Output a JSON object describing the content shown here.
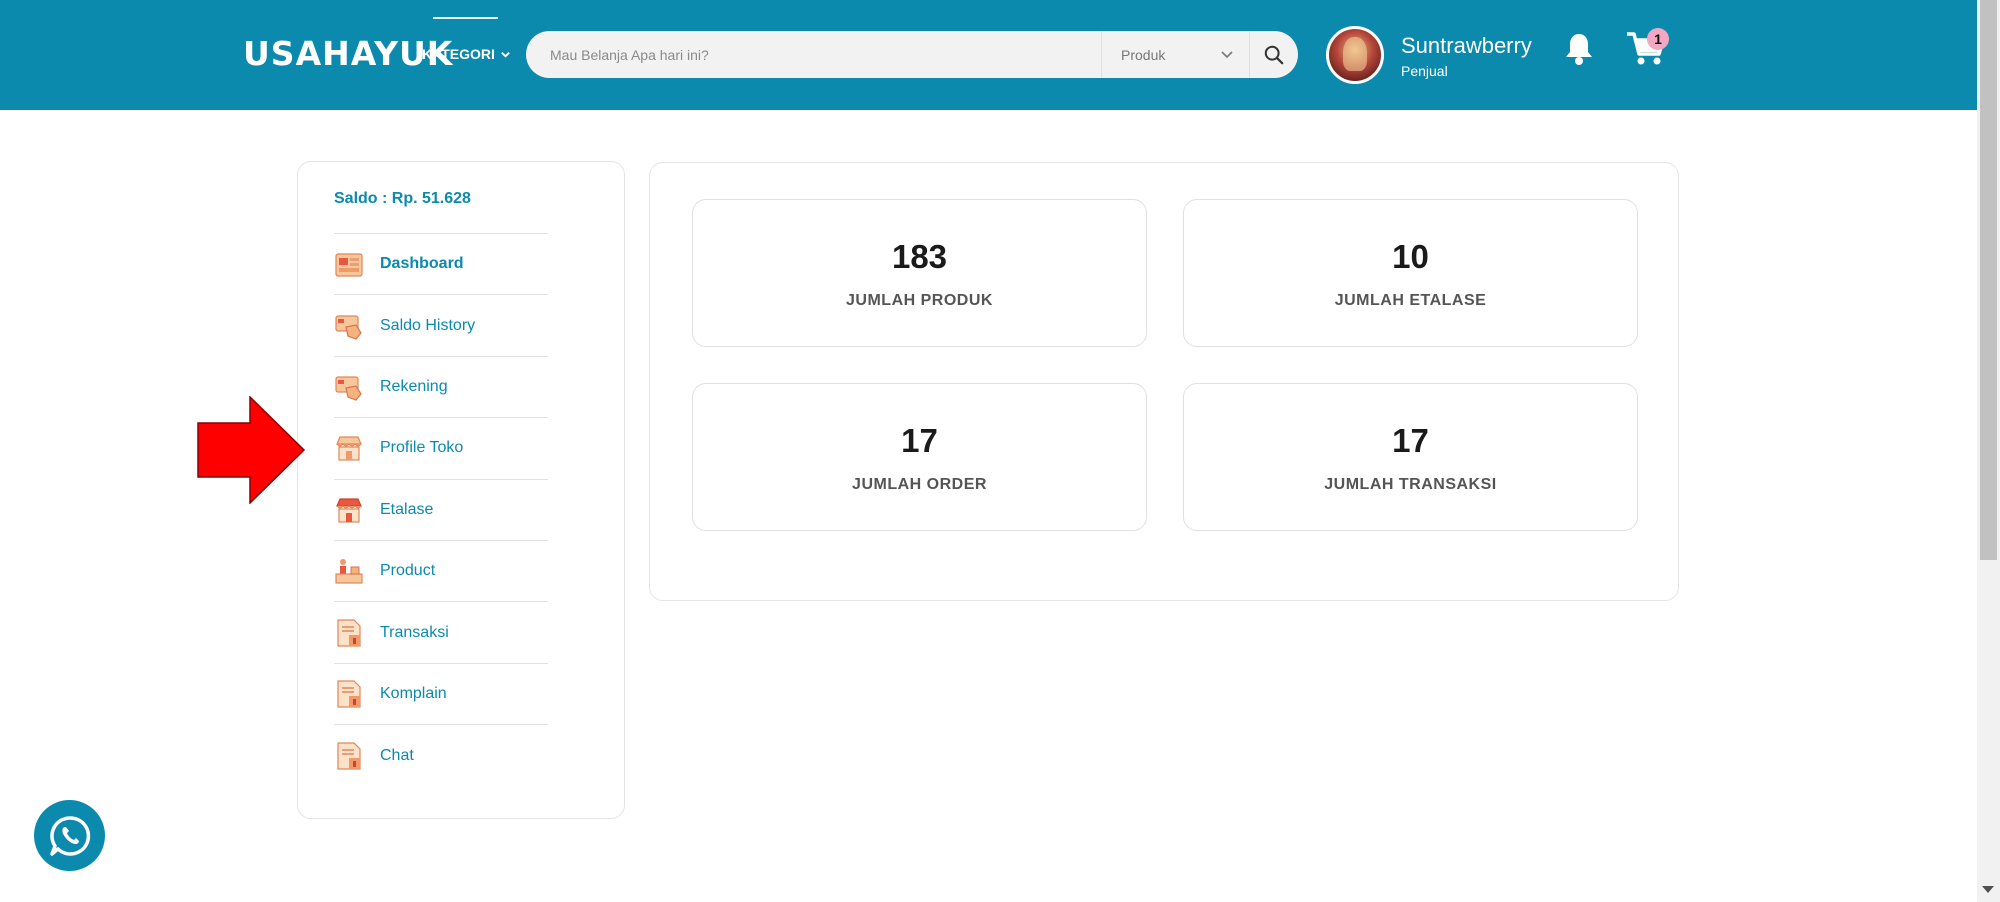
{
  "header": {
    "logo": "USAHAYUK",
    "kategori_label": "KATEGORI",
    "search": {
      "placeholder": "Mau Belanja Apa hari ini?",
      "category_value": "Produk"
    },
    "user": {
      "name": "Suntrawberry",
      "role": "Penjual"
    },
    "cart_count": "1",
    "brand_color": "#0b8aad"
  },
  "sidebar": {
    "saldo": "Saldo : Rp. 51.628",
    "items": [
      {
        "label": "Dashboard",
        "icon": "dashboard-icon"
      },
      {
        "label": "Saldo History",
        "icon": "saldo-history-icon"
      },
      {
        "label": "Rekening",
        "icon": "rekening-icon"
      },
      {
        "label": "Profile Toko",
        "icon": "store-icon"
      },
      {
        "label": "Etalase",
        "icon": "etalase-icon"
      },
      {
        "label": "Product",
        "icon": "product-icon"
      },
      {
        "label": "Transaksi",
        "icon": "transaksi-icon"
      },
      {
        "label": "Komplain",
        "icon": "komplain-icon"
      },
      {
        "label": "Chat",
        "icon": "chat-icon"
      }
    ]
  },
  "stats": [
    {
      "value": "183",
      "label": "JUMLAH PRODUK"
    },
    {
      "value": "10",
      "label": "JUMLAH ETALASE"
    },
    {
      "value": "17",
      "label": "JUMLAH ORDER"
    },
    {
      "value": "17",
      "label": "JUMLAH TRANSAKSI"
    }
  ],
  "annotation_color": "#ff0000"
}
